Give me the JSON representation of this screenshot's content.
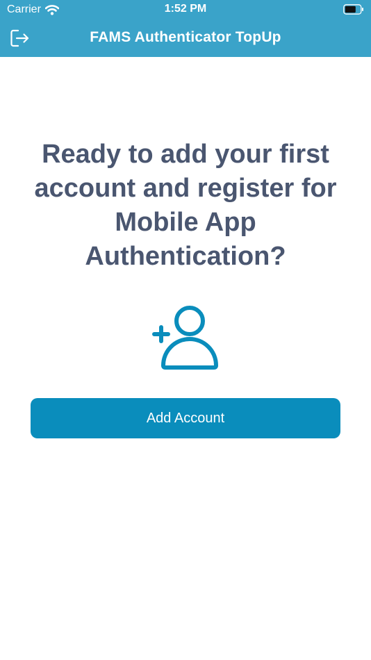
{
  "status_bar": {
    "carrier": "Carrier",
    "time": "1:52 PM",
    "wifi_icon": "wifi-icon",
    "battery_icon": "battery-icon"
  },
  "nav_bar": {
    "title": "FAMS Authenticator TopUp",
    "logout_icon": "logout-icon",
    "background_color": "#3aa3c9"
  },
  "main": {
    "headline": "Ready to add your first account and register for Mobile App Authentication?",
    "illustration_icon": "add-user-icon",
    "headline_color": "#4a5670",
    "icon_color": "#0a8dbc"
  },
  "actions": {
    "add_account_label": "Add Account",
    "button_color": "#0a8dbc"
  }
}
